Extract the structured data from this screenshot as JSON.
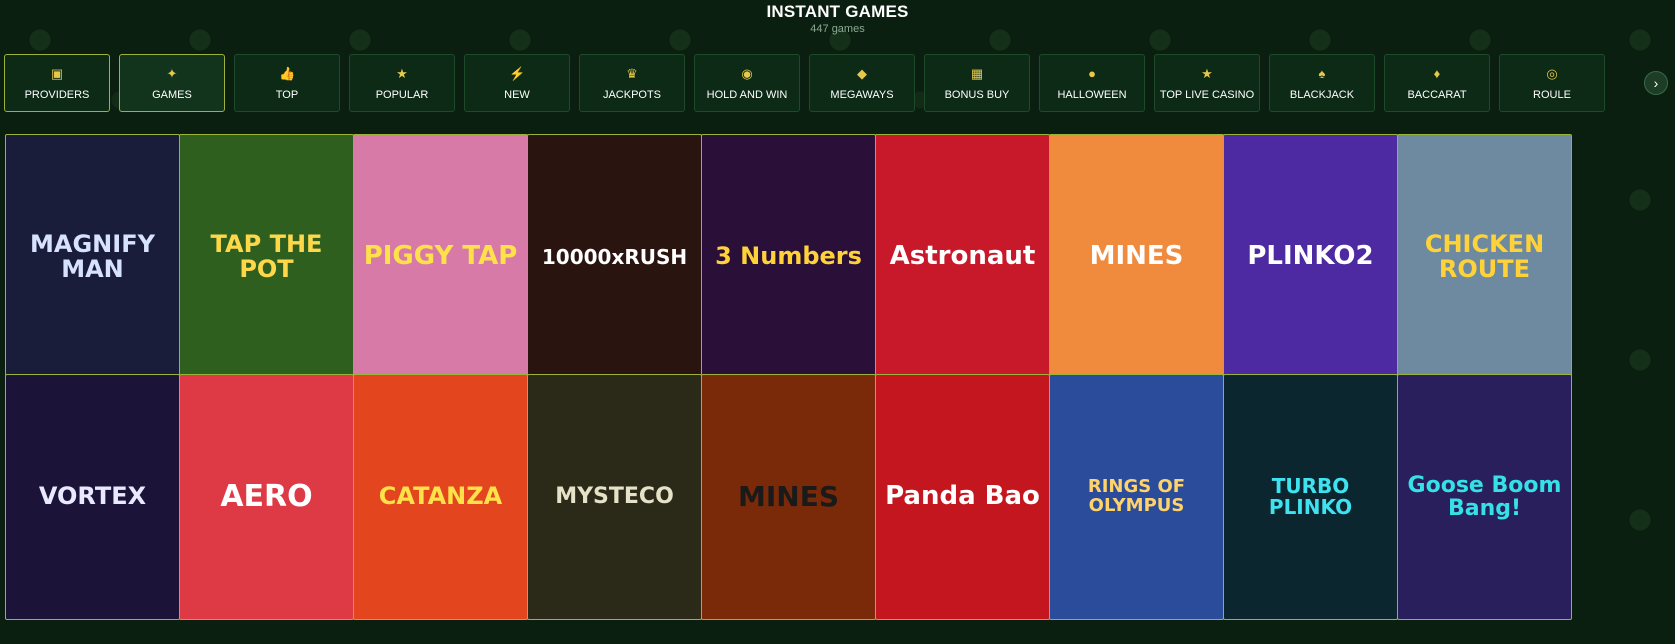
{
  "header": {
    "title": "INSTANT GAMES",
    "count": "447 games"
  },
  "categories": [
    {
      "label": "PROVIDERS",
      "icon": "providers-icon",
      "glyph": "▣",
      "active": false
    },
    {
      "label": "GAMES",
      "icon": "games-icon",
      "glyph": "✦",
      "active": true
    },
    {
      "label": "TOP",
      "icon": "thumbs-up-icon",
      "glyph": "👍",
      "active": false
    },
    {
      "label": "POPULAR",
      "icon": "star-icon",
      "glyph": "★",
      "active": false
    },
    {
      "label": "NEW",
      "icon": "lightning-icon",
      "glyph": "⚡",
      "active": false
    },
    {
      "label": "JACKPOTS",
      "icon": "jackpot-icon",
      "glyph": "♛",
      "active": false
    },
    {
      "label": "HOLD AND WIN",
      "icon": "hold-and-win-icon",
      "glyph": "◉",
      "active": false
    },
    {
      "label": "MEGAWAYS",
      "icon": "diamond-icon",
      "glyph": "◆",
      "active": false
    },
    {
      "label": "BONUS BUY",
      "icon": "gift-icon",
      "glyph": "▦",
      "active": false
    },
    {
      "label": "HALLOWEEN",
      "icon": "pumpkin-icon",
      "glyph": "●",
      "active": false
    },
    {
      "label": "TOP LIVE CASINO",
      "icon": "crown-icon",
      "glyph": "★",
      "active": false
    },
    {
      "label": "BLACKJACK",
      "icon": "blackjack-icon",
      "glyph": "♠",
      "active": false
    },
    {
      "label": "BACCARAT",
      "icon": "cards-icon",
      "glyph": "♦",
      "active": false
    },
    {
      "label": "ROULE",
      "icon": "roulette-icon",
      "glyph": "◎",
      "active": false
    }
  ],
  "next_arrow": "›",
  "games": [
    {
      "name": "MAGNIFY MAN",
      "bg": "#1a1d3a",
      "fg": "#d7e2ff",
      "size": 24
    },
    {
      "name": "TAP THE POT",
      "bg": "#2f5f1f",
      "fg": "#ffd84a",
      "size": 24
    },
    {
      "name": "PIGGY TAP",
      "bg": "#d77aa8",
      "fg": "#ffe14a",
      "size": 26
    },
    {
      "name": "10000xRUSH",
      "bg": "#2a1410",
      "fg": "#ffffff",
      "size": 20
    },
    {
      "name": "3 Numbers",
      "bg": "#2a1038",
      "fg": "#ffd23a",
      "size": 24
    },
    {
      "name": "Astronaut",
      "bg": "#c8192b",
      "fg": "#ffffff",
      "size": 26
    },
    {
      "name": "MINES",
      "bg": "#f08a3c",
      "fg": "#ffffff",
      "size": 26
    },
    {
      "name": "PLINKO2",
      "bg": "#4d2aa2",
      "fg": "#ffffff",
      "size": 26
    },
    {
      "name": "CHICKEN ROUTE",
      "bg": "#6e8aa0",
      "fg": "#ffd23a",
      "size": 24
    },
    {
      "name": "VORTEX",
      "bg": "#1b1338",
      "fg": "#e8e8ff",
      "size": 24
    },
    {
      "name": "AERO",
      "bg": "#de3a45",
      "fg": "#ffffff",
      "size": 30
    },
    {
      "name": "CATANZA",
      "bg": "#e3451f",
      "fg": "#ffe14a",
      "size": 24
    },
    {
      "name": "MYSTECO",
      "bg": "#2b2a18",
      "fg": "#e6e2c8",
      "size": 22
    },
    {
      "name": "MINES",
      "bg": "#7a2a08",
      "fg": "#1a1a1a",
      "size": 28
    },
    {
      "name": "Panda Bao",
      "bg": "#c4161f",
      "fg": "#ffffff",
      "size": 26
    },
    {
      "name": "RINGS OF OLYMPUS",
      "bg": "#2a4c9a",
      "fg": "#ffd36a",
      "size": 18
    },
    {
      "name": "TURBO PLINKO",
      "bg": "#0c2630",
      "fg": "#3fe3f0",
      "size": 20
    },
    {
      "name": "Goose Boom Bang!",
      "bg": "#281f5c",
      "fg": "#35e1e6",
      "size": 22
    }
  ]
}
